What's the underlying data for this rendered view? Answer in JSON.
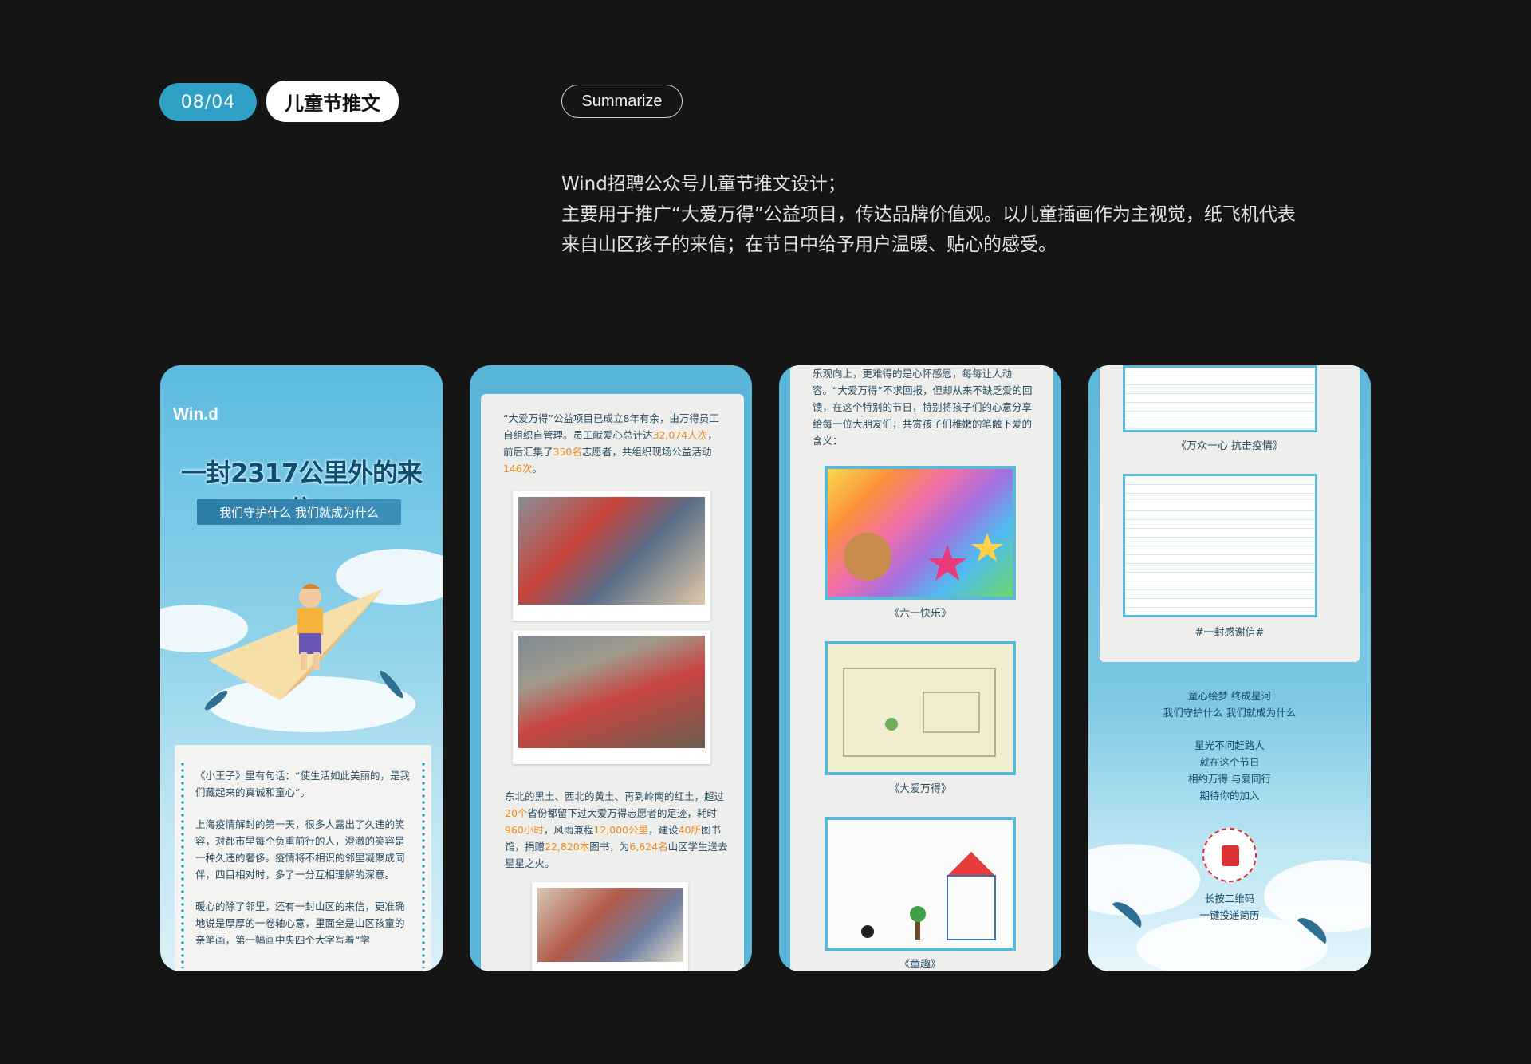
{
  "header": {
    "page_number": "08/04",
    "section_title": "儿童节推文",
    "summary_label": "Summarize",
    "description_lines": [
      "Wind招聘公众号儿童节推文设计；",
      "主要用于推广“大爱万得”公益项目，传达品牌价值观。以儿童插画作为主视觉，纸飞机代表",
      "来自山区孩子的来信；在节日中给予用户温暖、贴心的感受。"
    ]
  },
  "phone1": {
    "logo": "Win.d",
    "headline": "一封2317公里外的来信",
    "banner": "我们守护什么 我们就成为什么",
    "para1": "《小王子》里有句话：“使生活如此美丽的，是我们藏起来的真诚和童心”。",
    "para2": "上海疫情解封的第一天，很多人露出了久违的笑容，对都市里每个负重前行的人，澄澈的笑容是一种久违的奢侈。疫情将不相识的邻里凝聚成同伴，四目相对时，多了一分互相理解的深意。",
    "para3": "暖心的除了邻里，还有一封山区的来信，更准确地说是厚厚的一卷轴心意，里面全是山区孩童的亲笔画，第一幅画中央四个大字写着“学"
  },
  "phone2": {
    "p1_a": "“大爱万得”公益项目已成立8年有余，由万得员工自组织自管理。员工献爱心总计达",
    "p1_h1": "32,074人次",
    "p1_b": "，前后汇集了",
    "p1_h2": "350名",
    "p1_c": "志愿者，共组织现场公益活动",
    "p1_h3": "146次",
    "p1_d": "。",
    "p2_a": "东北的黑土、西北的黄土、再到岭南的红土，超过",
    "p2_h1": "20个",
    "p2_b": "省份都留下过大爱万得志愿者的足迹，耗时",
    "p2_h2": "960小时",
    "p2_c": "，风雨兼程",
    "p2_h3": "12,000公里",
    "p2_d": "，建设",
    "p2_h4": "40所",
    "p2_e": "图书馆，捐赠",
    "p2_h5": "22,820本",
    "p2_f": "图书，为",
    "p2_h6": "6,624名",
    "p2_g": "山区学生送去星星之火。"
  },
  "phone3": {
    "intro": "乐观向上，更难得的是心怀感恩，每每让人动容。“大爱万得”不求回报，但却从来不缺乏爱的回馈，在这个特别的节日，特别将孩子们的心意分享给每一位大朋友们，共赏孩子们稚嫩的笔触下爱的含义：",
    "drawing1_caption": "《六一快乐》",
    "drawing2_caption": "《大爱万得》",
    "drawing3_caption": "《童趣》"
  },
  "phone4": {
    "caption1": "《万众一心 抗击疫情》",
    "caption2": "#一封感谢信#",
    "outro1": "童心绘梦 终成星河",
    "outro2": "我们守护什么 我们就成为什么",
    "outro3": "星光不问赶路人",
    "outro4": "就在这个节日",
    "outro5": "相约万得 与爱同行",
    "outro6": "期待你的加入",
    "qr_line1": "长按二维码",
    "qr_line2": "一键投递简历"
  },
  "colors": {
    "background": "#151515",
    "accent_blue": "#2ea0c6",
    "highlight_orange": "#f08a1c",
    "frame_blue": "#5db8d8"
  }
}
